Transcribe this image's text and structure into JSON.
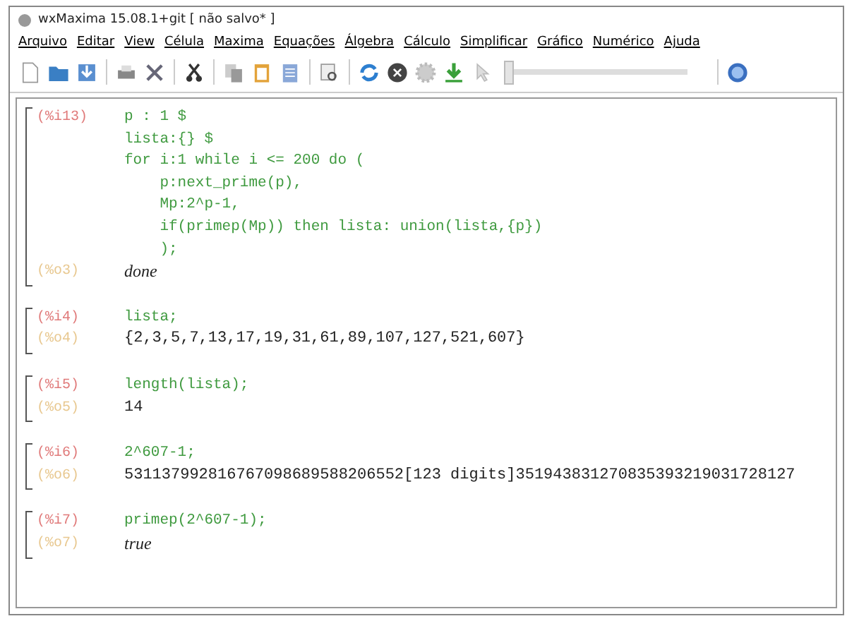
{
  "window": {
    "title": "wxMaxima 15.08.1+git [ não salvo* ]"
  },
  "menu": [
    "Arquivo",
    "Editar",
    "View",
    "Célula",
    "Maxima",
    "Equações",
    "Álgebra",
    "Cálculo",
    "Simplificar",
    "Gráfico",
    "Numérico",
    "Ajuda"
  ],
  "toolbar": {
    "slider": {
      "level": 0
    }
  },
  "cells": [
    {
      "input_label": "(%i13)",
      "input_lines": [
        "p : 1 $",
        "lista:{} $",
        "for i:1 while i <= 200 do (",
        "    p:next_prime(p),",
        "    Mp:2^p-1,",
        "    if(primep(Mp)) then lista: union(lista,{p})",
        "    );"
      ],
      "output_label": "(%o3)",
      "output": "done",
      "kind": "symbol"
    },
    {
      "input_label": "(%i4)",
      "input_lines": [
        "lista;"
      ],
      "output_label": "(%o4)",
      "output": "{2,3,5,7,13,17,19,31,61,89,107,127,521,607}",
      "kind": "number"
    },
    {
      "input_label": "(%i5)",
      "input_lines": [
        "length(lista);"
      ],
      "output_label": "(%o5)",
      "output": "14",
      "kind": "number"
    },
    {
      "input_label": "(%i6)",
      "input_lines": [
        "2^607-1;"
      ],
      "output_label": "(%o6)",
      "output": "531137992816767098689588206552[123 digits]351943831270835393219031728127",
      "kind": "number"
    },
    {
      "input_label": "(%i7)",
      "input_lines": [
        "primep(2^607-1);"
      ],
      "output_label": "(%o7)",
      "output": "true",
      "kind": "symbol"
    }
  ]
}
